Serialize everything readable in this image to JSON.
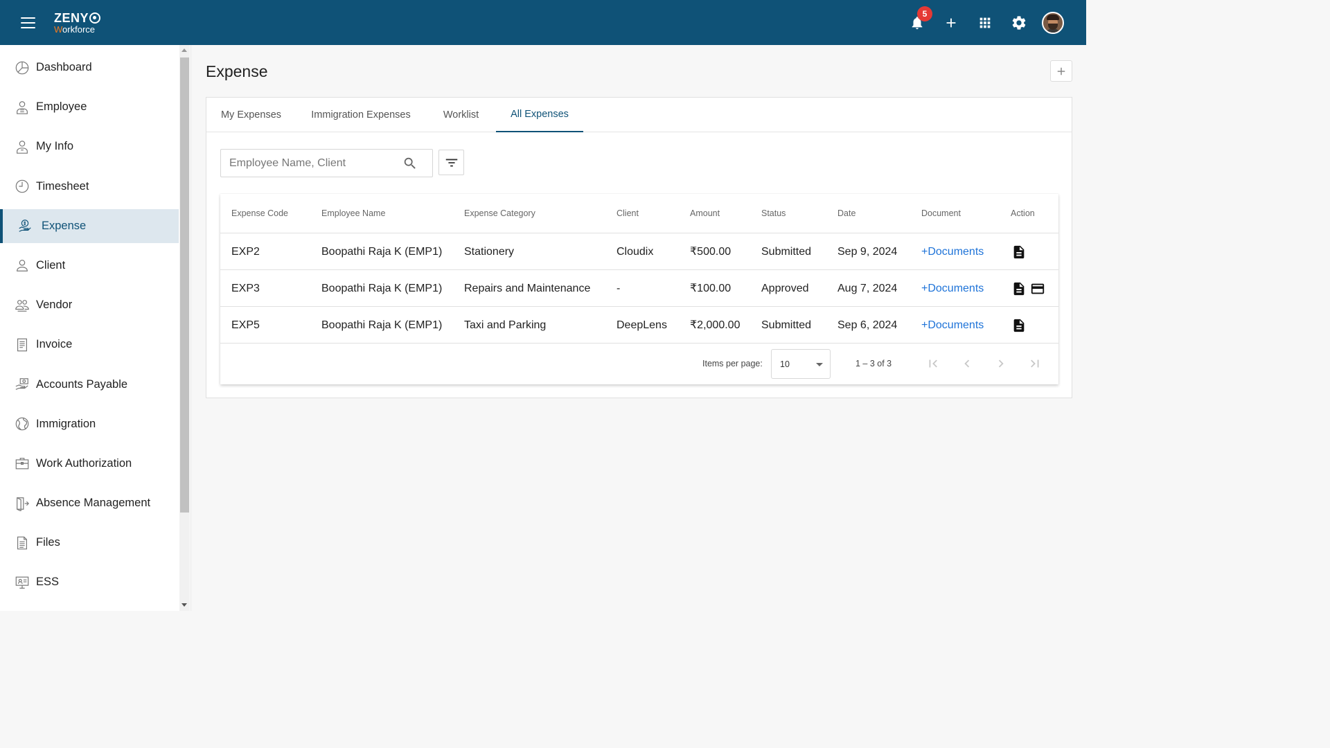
{
  "header": {
    "brand": "ZENY",
    "brand_sub_first": "W",
    "brand_sub_rest": "orkforce",
    "notification_count": "5",
    "bar_color": "#0f5277"
  },
  "sidebar": {
    "items": [
      {
        "label": "Dashboard",
        "icon": "dashboard-icon"
      },
      {
        "label": "Employee",
        "icon": "employee-icon"
      },
      {
        "label": "My Info",
        "icon": "my-info-icon"
      },
      {
        "label": "Timesheet",
        "icon": "clock-icon"
      },
      {
        "label": "Expense",
        "icon": "expense-icon",
        "active": true
      },
      {
        "label": "Client",
        "icon": "person-icon"
      },
      {
        "label": "Vendor",
        "icon": "vendor-icon"
      },
      {
        "label": "Invoice",
        "icon": "invoice-icon"
      },
      {
        "label": "Accounts Payable",
        "icon": "accounts-payable-icon"
      },
      {
        "label": "Immigration",
        "icon": "globe-icon"
      },
      {
        "label": "Work Authorization",
        "icon": "briefcase-icon"
      },
      {
        "label": "Absence Management",
        "icon": "door-exit-icon"
      },
      {
        "label": "Files",
        "icon": "file-icon"
      },
      {
        "label": "ESS",
        "icon": "monitor-icon"
      }
    ]
  },
  "page": {
    "title": "Expense"
  },
  "tabs": [
    {
      "label": "My Expenses",
      "active": false
    },
    {
      "label": "Immigration Expenses",
      "active": false
    },
    {
      "label": "Worklist",
      "active": false
    },
    {
      "label": "All Expenses",
      "active": true
    }
  ],
  "search": {
    "placeholder": "Employee Name, Client",
    "value": ""
  },
  "table": {
    "columns": [
      "Expense Code",
      "Employee Name",
      "Expense Category",
      "Client",
      "Amount",
      "Status",
      "Date",
      "Document",
      "Action"
    ],
    "rows": [
      {
        "code": "EXP2",
        "employee": "Boopathi Raja K (EMP1)",
        "category": "Stationery",
        "client": "Cloudix",
        "amount": "₹500.00",
        "status": "Submitted",
        "date": "Sep 9, 2024",
        "document": "+Documents",
        "actions": [
          "document-icon"
        ]
      },
      {
        "code": "EXP3",
        "employee": "Boopathi Raja K (EMP1)",
        "category": "Repairs and Maintenance",
        "client": "-",
        "amount": "₹100.00",
        "status": "Approved",
        "date": "Aug 7, 2024",
        "document": "+Documents",
        "actions": [
          "document-icon",
          "payment-card-icon"
        ]
      },
      {
        "code": "EXP5",
        "employee": "Boopathi Raja K (EMP1)",
        "category": "Taxi and Parking",
        "client": "DeepLens",
        "amount": "₹2,000.00",
        "status": "Submitted",
        "date": "Sep 6, 2024",
        "document": "+Documents",
        "actions": [
          "document-icon"
        ]
      }
    ]
  },
  "paginator": {
    "items_per_page_label": "Items per page:",
    "items_per_page_value": "10",
    "range_label": "1 – 3 of 3"
  }
}
